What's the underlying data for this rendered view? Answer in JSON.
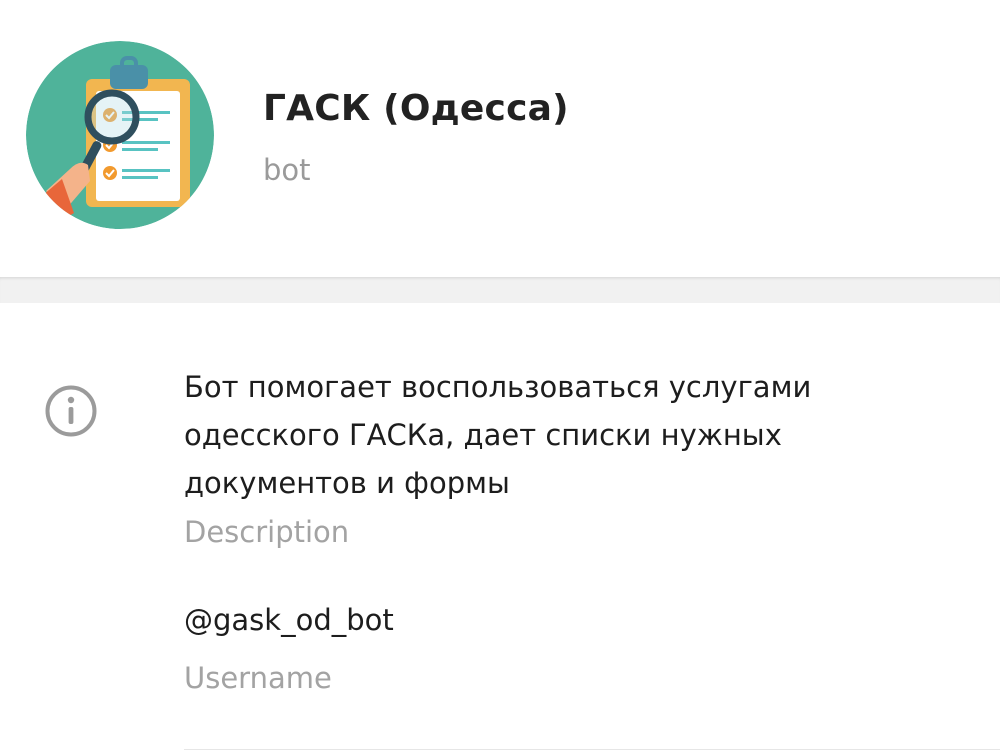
{
  "profile": {
    "name": "ГАСК (Одесса)",
    "status": "bot",
    "avatar_icon": "clipboard-magnifier-avatar"
  },
  "info": {
    "icon": "info-icon",
    "description": "Бот помогает воспользоваться услугами одесского ГАСКа, дает списки нужных документов и формы",
    "description_label": "Description",
    "username": "@gask_od_bot",
    "username_label": "Username"
  },
  "colors": {
    "avatar_bg": "#4fb39a",
    "title": "#222222",
    "muted": "#a3a3a3",
    "divider": "#f1f1f1"
  }
}
